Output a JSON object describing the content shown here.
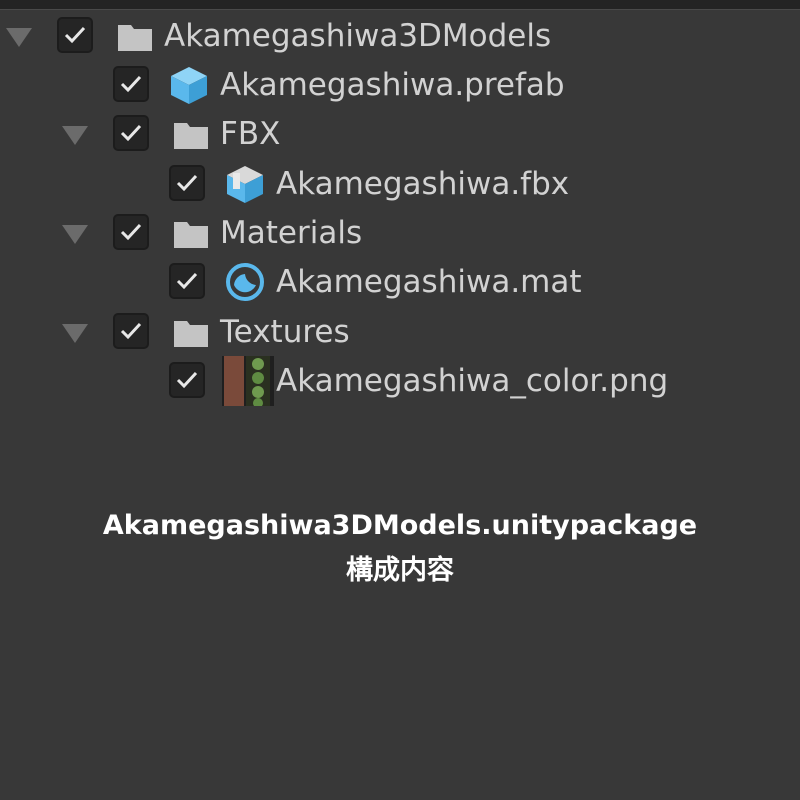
{
  "tree": {
    "root": {
      "label": "Akamegashiwa3DModels",
      "checked": true,
      "expanded": true,
      "icon": "folder-icon"
    },
    "prefab": {
      "label": "Akamegashiwa.prefab",
      "checked": true,
      "icon": "prefab-cube-icon"
    },
    "fbx_folder": {
      "label": "FBX",
      "checked": true,
      "expanded": true,
      "icon": "folder-icon"
    },
    "fbx_file": {
      "label": "Akamegashiwa.fbx",
      "checked": true,
      "icon": "model-icon"
    },
    "materials_folder": {
      "label": "Materials",
      "checked": true,
      "expanded": true,
      "icon": "folder-icon"
    },
    "material_file": {
      "label": "Akamegashiwa.mat",
      "checked": true,
      "icon": "material-sphere-icon"
    },
    "textures_folder": {
      "label": "Textures",
      "checked": true,
      "expanded": true,
      "icon": "folder-icon"
    },
    "texture_file": {
      "label": "Akamegashiwa_color.png",
      "checked": true,
      "icon": "texture-thumbnail-icon"
    }
  },
  "caption": {
    "line1": "Akamegashiwa3DModels.unitypackage",
    "line2": "構成内容"
  },
  "colors": {
    "background": "#383838",
    "text": "#d2d2d2",
    "folder": "#c4c4c4",
    "unity_blue": "#5ab8ec"
  }
}
